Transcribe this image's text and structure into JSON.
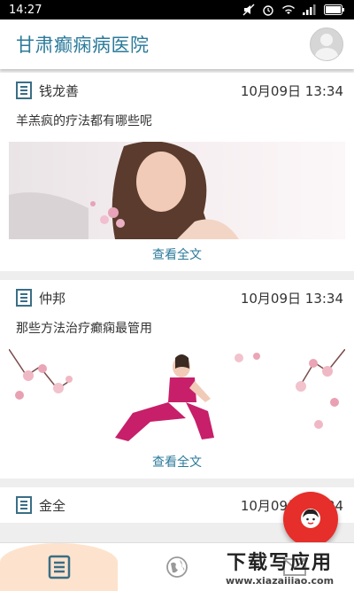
{
  "statusbar": {
    "time": "14:27"
  },
  "app": {
    "title": "甘肃癫痫病医院"
  },
  "posts": [
    {
      "author": "钱龙善",
      "time": "10月09日 13:34",
      "title": "羊羔疯的疗法都有哪些呢",
      "read_more": "查看全文"
    },
    {
      "author": "仲邦",
      "time": "10月09日 13:34",
      "title": "那些方法治疗癫痫最管用",
      "read_more": "查看全文"
    },
    {
      "author": "金全",
      "time": "10月09日 13:34"
    }
  ],
  "watermark": {
    "main": "下载写应用",
    "sub": "www.xiazaiiiao.com"
  },
  "icons": {
    "bottom_nav": [
      "article-list-icon",
      "globe-icon",
      "mail-icon"
    ],
    "fab": "doctor-avatar-icon"
  }
}
